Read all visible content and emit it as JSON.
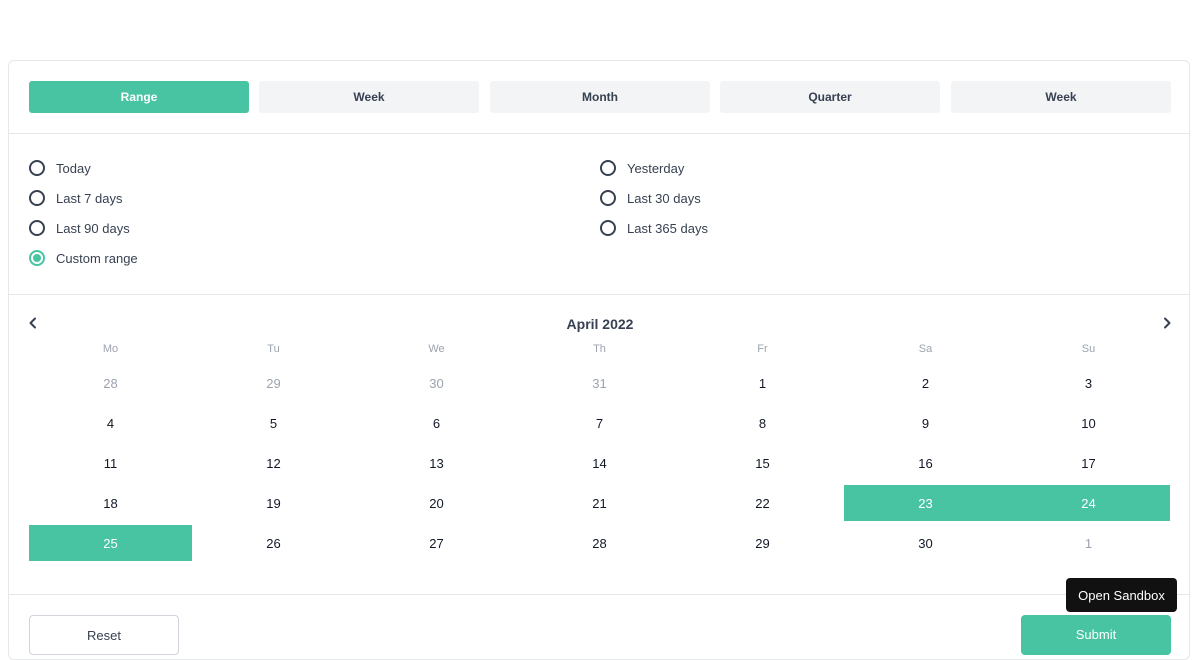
{
  "tabs": [
    {
      "label": "Range",
      "active": true
    },
    {
      "label": "Week",
      "active": false
    },
    {
      "label": "Month",
      "active": false
    },
    {
      "label": "Quarter",
      "active": false
    },
    {
      "label": "Week",
      "active": false
    }
  ],
  "presets": {
    "left": [
      {
        "label": "Today",
        "checked": false
      },
      {
        "label": "Last 7 days",
        "checked": false
      },
      {
        "label": "Last 90 days",
        "checked": false
      },
      {
        "label": "Custom range",
        "checked": true
      }
    ],
    "right": [
      {
        "label": "Yesterday",
        "checked": false
      },
      {
        "label": "Last 30 days",
        "checked": false
      },
      {
        "label": "Last 365 days",
        "checked": false
      }
    ]
  },
  "calendar": {
    "month_label": "April 2022",
    "weekdays": [
      "Mo",
      "Tu",
      "We",
      "Th",
      "Fr",
      "Sa",
      "Su"
    ],
    "weeks": [
      [
        {
          "d": "28",
          "muted": true
        },
        {
          "d": "29",
          "muted": true
        },
        {
          "d": "30",
          "muted": true
        },
        {
          "d": "31",
          "muted": true
        },
        {
          "d": "1"
        },
        {
          "d": "2"
        },
        {
          "d": "3"
        }
      ],
      [
        {
          "d": "4"
        },
        {
          "d": "5"
        },
        {
          "d": "6"
        },
        {
          "d": "7"
        },
        {
          "d": "8"
        },
        {
          "d": "9"
        },
        {
          "d": "10"
        }
      ],
      [
        {
          "d": "11"
        },
        {
          "d": "12"
        },
        {
          "d": "13"
        },
        {
          "d": "14"
        },
        {
          "d": "15"
        },
        {
          "d": "16"
        },
        {
          "d": "17"
        }
      ],
      [
        {
          "d": "18"
        },
        {
          "d": "19"
        },
        {
          "d": "20"
        },
        {
          "d": "21"
        },
        {
          "d": "22"
        },
        {
          "d": "23",
          "selected": true
        },
        {
          "d": "24",
          "selected": true
        }
      ],
      [
        {
          "d": "25",
          "selected": true
        },
        {
          "d": "26"
        },
        {
          "d": "27"
        },
        {
          "d": "28"
        },
        {
          "d": "29"
        },
        {
          "d": "30"
        },
        {
          "d": "1",
          "muted": true
        }
      ]
    ],
    "prev_icon": "chevron-left-icon",
    "next_icon": "chevron-right-icon"
  },
  "footer": {
    "reset_label": "Reset",
    "submit_label": "Submit"
  },
  "sandbox_label": "Open Sandbox",
  "colors": {
    "accent": "#48c4a2",
    "tab_bg": "#f3f4f6",
    "muted_text": "#9ca3af",
    "tooltip_bg": "#111111"
  }
}
